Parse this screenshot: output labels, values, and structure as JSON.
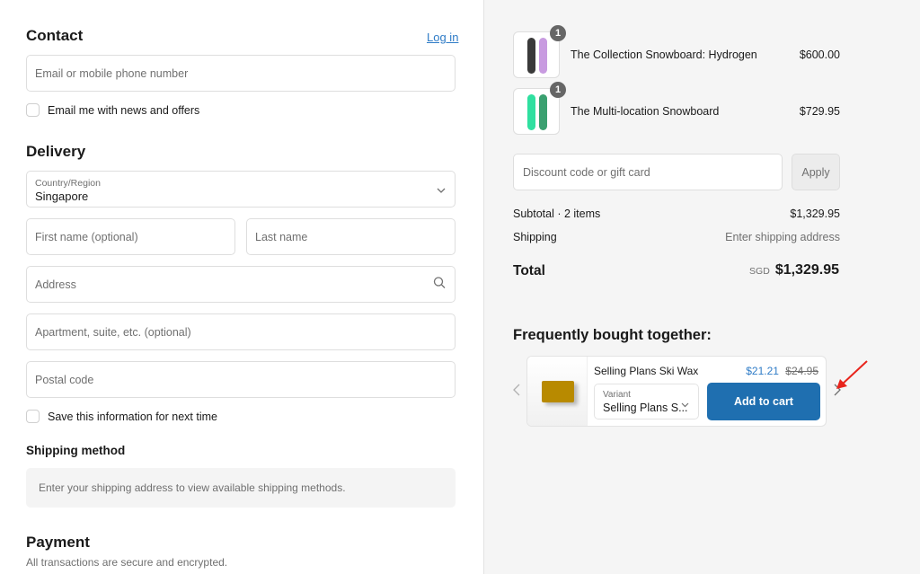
{
  "contact": {
    "title": "Contact",
    "login_link": "Log in",
    "email_placeholder": "Email or mobile phone number",
    "newsletter_label": "Email me with news and offers"
  },
  "delivery": {
    "title": "Delivery",
    "country_label": "Country/Region",
    "country_value": "Singapore",
    "first_name_placeholder": "First name (optional)",
    "last_name_placeholder": "Last name",
    "address_placeholder": "Address",
    "apartment_placeholder": "Apartment, suite, etc. (optional)",
    "postal_placeholder": "Postal code",
    "save_info_label": "Save this information for next time"
  },
  "shipping_method": {
    "title": "Shipping method",
    "notice": "Enter your shipping address to view available shipping methods."
  },
  "payment": {
    "title": "Payment",
    "subtitle": "All transactions are secure and encrypted."
  },
  "order_summary": {
    "items": [
      {
        "name": "The Collection Snowboard: Hydrogen",
        "price": "$600.00",
        "quantity": "1",
        "colors": [
          "#3a3a3a",
          "#c89be0"
        ]
      },
      {
        "name": "The Multi-location Snowboard",
        "price": "$729.95",
        "quantity": "1",
        "colors": [
          "#2fe0a0",
          "#3aa070"
        ]
      }
    ],
    "discount_placeholder": "Discount code or gift card",
    "apply_label": "Apply",
    "subtotal_label": "Subtotal · 2 items",
    "subtotal_value": "$1,329.95",
    "shipping_label": "Shipping",
    "shipping_value": "Enter shipping address",
    "total_label": "Total",
    "total_currency": "SGD",
    "total_value": "$1,329.95"
  },
  "frequently_bought": {
    "title": "Frequently bought together:",
    "product_name": "Selling Plans Ski Wax",
    "sale_price": "$21.21",
    "original_price": "$24.95",
    "variant_label": "Variant",
    "variant_value": "Selling Plans S...",
    "add_to_cart_label": "Add to cart"
  },
  "colors": {
    "accent": "#1f6fb0",
    "link": "#2f7cc7",
    "annotation_arrow": "#e8241c"
  }
}
